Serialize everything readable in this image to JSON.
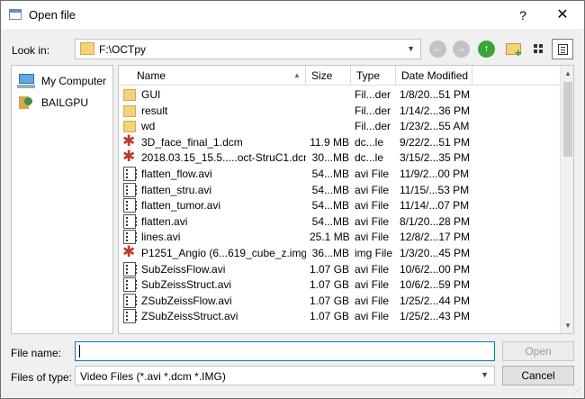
{
  "window": {
    "title": "Open file",
    "help_glyph": "?",
    "close_glyph": "✕"
  },
  "lookin": {
    "label": "Look in:",
    "value": "F:\\OCTpy"
  },
  "nav": {
    "back_glyph": "←",
    "forward_glyph": "→",
    "up_glyph": "↑"
  },
  "sidebar": {
    "items": [
      {
        "label": "My Computer",
        "icon": "computer-icon"
      },
      {
        "label": "BAILGPU",
        "icon": "user-icon"
      }
    ]
  },
  "columns": {
    "name": "Name",
    "size": "Size",
    "type": "Type",
    "date": "Date Modified"
  },
  "files": [
    {
      "icon": "folder",
      "name": "GUI",
      "size": "",
      "type": "Fil...der",
      "date": "1/8/20...51 PM"
    },
    {
      "icon": "folder",
      "name": "result",
      "size": "",
      "type": "Fil...der",
      "date": "1/14/2...36 PM"
    },
    {
      "icon": "folder",
      "name": "wd",
      "size": "",
      "type": "Fil...der",
      "date": "1/23/2...55 AM"
    },
    {
      "icon": "dicom",
      "name": "3D_face_final_1.dcm",
      "size": "11.9 MB",
      "type": "dc...le",
      "date": "9/22/2...51 PM"
    },
    {
      "icon": "dicom",
      "name": "2018.03.15_15.5.....oct-StruC1.dcm",
      "size": "30...MB",
      "type": "dc...le",
      "date": "3/15/2...35 PM"
    },
    {
      "icon": "film",
      "name": "flatten_flow.avi",
      "size": "54...MB",
      "type": "avi File",
      "date": "11/9/2...00 PM"
    },
    {
      "icon": "film",
      "name": "flatten_stru.avi",
      "size": "54...MB",
      "type": "avi File",
      "date": "11/15/...53 PM"
    },
    {
      "icon": "film",
      "name": "flatten_tumor.avi",
      "size": "54...MB",
      "type": "avi File",
      "date": "11/14/...07 PM"
    },
    {
      "icon": "film",
      "name": "flatten.avi",
      "size": "54...MB",
      "type": "avi File",
      "date": "8/1/20...28 PM"
    },
    {
      "icon": "film",
      "name": "lines.avi",
      "size": "25.1 MB",
      "type": "avi File",
      "date": "12/8/2...17 PM"
    },
    {
      "icon": "dicom",
      "name": "P1251_Angio (6...619_cube_z.img",
      "size": "36...MB",
      "type": "img File",
      "date": "1/3/20...45 PM"
    },
    {
      "icon": "film",
      "name": "SubZeissFlow.avi",
      "size": "1.07 GB",
      "type": "avi File",
      "date": "10/6/2...00 PM"
    },
    {
      "icon": "film",
      "name": "SubZeissStruct.avi",
      "size": "1.07 GB",
      "type": "avi File",
      "date": "10/6/2...59 PM"
    },
    {
      "icon": "film",
      "name": "ZSubZeissFlow.avi",
      "size": "1.07 GB",
      "type": "avi File",
      "date": "1/25/2...44 PM"
    },
    {
      "icon": "film",
      "name": "ZSubZeissStruct.avi",
      "size": "1.07 GB",
      "type": "avi File",
      "date": "1/25/2...43 PM"
    }
  ],
  "filename": {
    "label": "File name:",
    "value": ""
  },
  "filetype": {
    "label": "Files of type:",
    "value": "Video Files (*.avi *.dcm *.IMG)"
  },
  "buttons": {
    "open": "Open",
    "cancel": "Cancel"
  },
  "colors": {
    "accent": "#0078d7",
    "up_arrow": "#3aa33a",
    "folder": "#f3d27a",
    "dicom": "#c0392b"
  }
}
